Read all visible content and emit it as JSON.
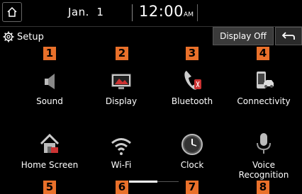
{
  "status": {
    "date": "Jan.  1",
    "time": "12:00",
    "ampm": "AM"
  },
  "header": {
    "title": "Setup",
    "display_off_label": "Display Off"
  },
  "menu": [
    {
      "label": "Sound",
      "icon": "speaker-icon",
      "badge": "1"
    },
    {
      "label": "Display",
      "icon": "monitor-icon",
      "badge": "2"
    },
    {
      "label": "Bluetooth",
      "icon": "bluetooth-phone-icon",
      "badge": "3"
    },
    {
      "label": "Connectivity",
      "icon": "phone-car-icon",
      "badge": "4"
    },
    {
      "label": "Home Screen",
      "icon": "home-screen-icon",
      "badge": "5"
    },
    {
      "label": "Wi-Fi",
      "icon": "wifi-icon",
      "badge": "6"
    },
    {
      "label": "Clock",
      "icon": "clock-icon",
      "badge": "7"
    },
    {
      "label": "Voice\nRecognition",
      "icon": "microphone-icon",
      "badge": "8"
    }
  ],
  "colors": {
    "badge": "#e9702a",
    "background": "#000000",
    "accent": "#4aa3e0"
  }
}
